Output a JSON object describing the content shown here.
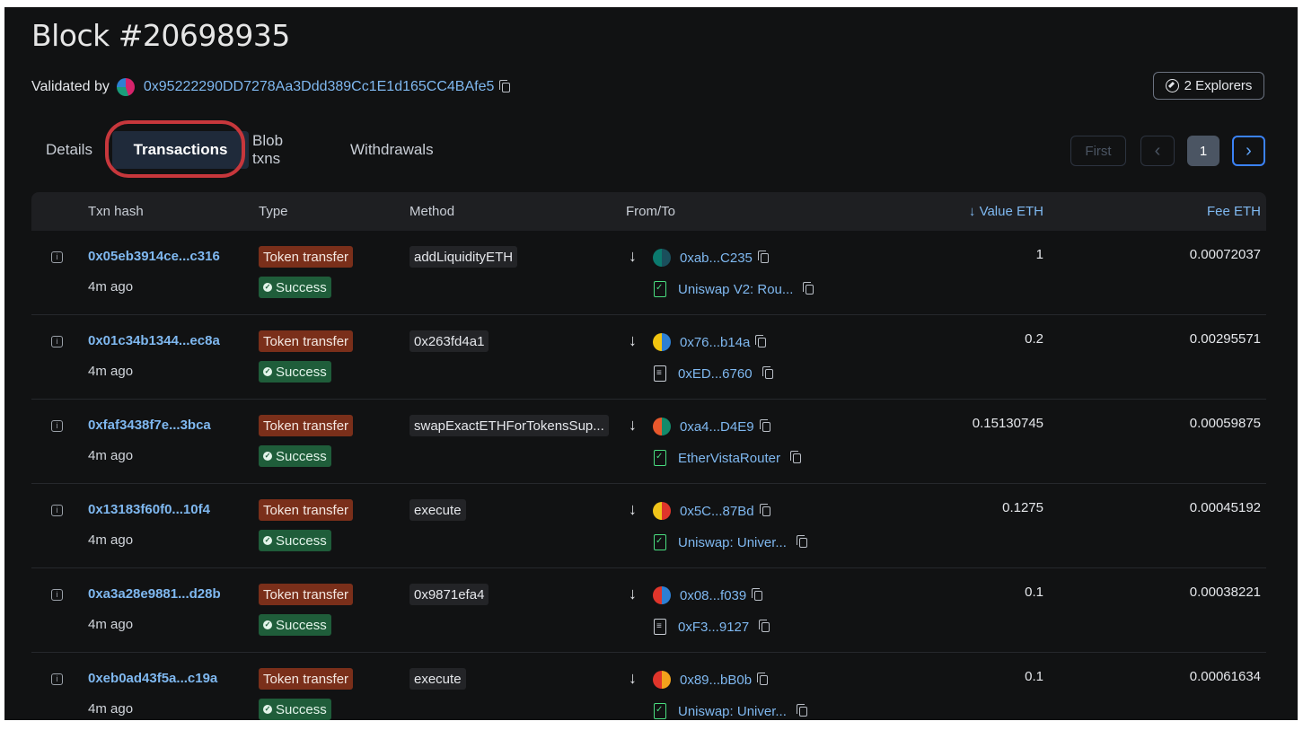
{
  "page_title": "Block #20698935",
  "validated_by": {
    "label": "Validated by",
    "address": "0x95222290DD7278Aa3Ddd389Cc1E1d165CC4BAfe5"
  },
  "explorers_label": "2 Explorers",
  "tabs": [
    {
      "label": "Details"
    },
    {
      "label": "Transactions",
      "active": true
    },
    {
      "label": "Blob txns"
    },
    {
      "label": "Withdrawals"
    }
  ],
  "pagination": {
    "first": "First",
    "prev": "‹",
    "current": "1",
    "next": "›"
  },
  "table": {
    "headers": {
      "hash": "Txn hash",
      "type": "Type",
      "method": "Method",
      "fromto": "From/To",
      "value": "Value ETH",
      "fee": "Fee ETH"
    },
    "rows": [
      {
        "hash": "0x05eb3914ce...c316",
        "age": "4m ago",
        "type": "Token transfer",
        "status": "Success",
        "method": "addLiquidityETH",
        "from": "0xab...C235",
        "to": "Uniswap V2: Rou...",
        "to_kind": "contract",
        "value": "1",
        "fee": "0.00072037",
        "avatar": [
          "#0b7a6e",
          "#1a4f5c"
        ]
      },
      {
        "hash": "0x01c34b1344...ec8a",
        "age": "4m ago",
        "type": "Token transfer",
        "status": "Success",
        "method": "0x263fd4a1",
        "from": "0x76...b14a",
        "to": "0xED...6760",
        "to_kind": "plain",
        "value": "0.2",
        "fee": "0.00295571",
        "avatar": [
          "#f1c40f",
          "#2d7fd3"
        ]
      },
      {
        "hash": "0xfaf3438f7e...3bca",
        "age": "4m ago",
        "type": "Token transfer",
        "status": "Success",
        "method": "swapExactETHForTokensSup...",
        "from": "0xa4...D4E9",
        "to": "EtherVistaRouter",
        "to_kind": "contract",
        "value": "0.15130745",
        "fee": "0.00059875",
        "avatar": [
          "#e8582c",
          "#138a6a"
        ]
      },
      {
        "hash": "0x13183f60f0...10f4",
        "age": "4m ago",
        "type": "Token transfer",
        "status": "Success",
        "method": "execute",
        "from": "0x5C...87Bd",
        "to": "Uniswap: Univer...",
        "to_kind": "contract",
        "value": "0.1275",
        "fee": "0.00045192",
        "avatar": [
          "#f0c419",
          "#e0352b"
        ]
      },
      {
        "hash": "0xa3a28e9881...d28b",
        "age": "4m ago",
        "type": "Token transfer",
        "status": "Success",
        "method": "0x9871efa4",
        "from": "0x08...f039",
        "to": "0xF3...9127",
        "to_kind": "plain",
        "value": "0.1",
        "fee": "0.00038221",
        "avatar": [
          "#e0352b",
          "#2d7fd3"
        ]
      },
      {
        "hash": "0xeb0ad43f5a...c19a",
        "age": "4m ago",
        "type": "Token transfer",
        "status": "Success",
        "method": "execute",
        "from": "0x89...bB0b",
        "to": "Uniswap: Univer...",
        "to_kind": "contract",
        "value": "0.1",
        "fee": "0.00061634",
        "avatar": [
          "#e0352b",
          "#f2a21c"
        ]
      }
    ]
  },
  "colors": {
    "link": "#7fb8f0",
    "type_badge": "#7a2f1a",
    "success_badge": "#1f5d3a",
    "highlight_ring": "#c7373c"
  }
}
